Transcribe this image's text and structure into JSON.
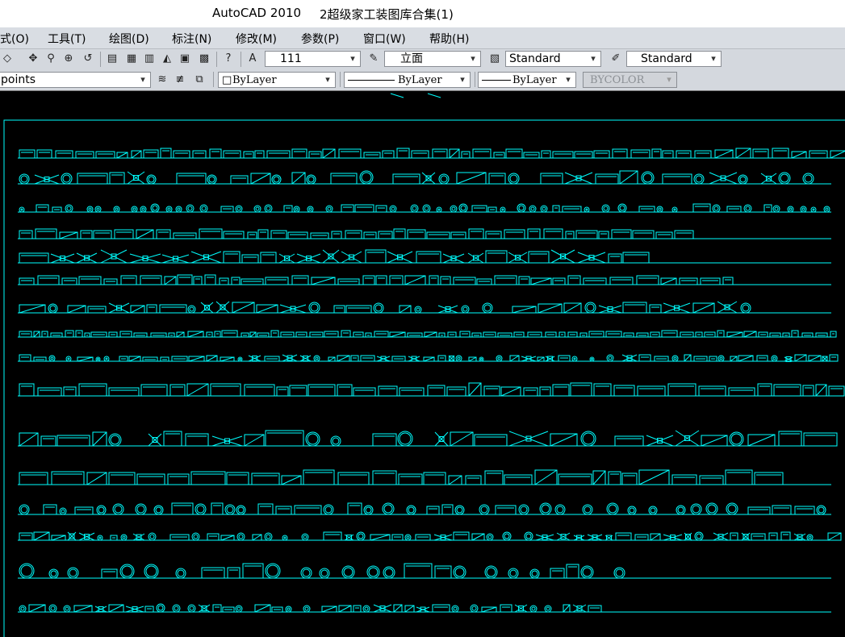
{
  "window": {
    "app_name": "AutoCAD 2010",
    "document": "2超级家工装图库合集(1)"
  },
  "menu": [
    "式(O)",
    "工具(T)",
    "绘图(D)",
    "标注(N)",
    "修改(M)",
    "参数(P)",
    "窗口(W)",
    "帮助(H)"
  ],
  "toolbar1": {
    "scale_value": "111",
    "view_value": "立面",
    "text_style": "Standard",
    "dim_style": "Standard"
  },
  "toolbar2": {
    "layer_value": "points",
    "color_value": "ByLayer",
    "linetype_value": "ByLayer",
    "lineweight_value": "ByLayer",
    "plotstyle_value": "BYCOLOR"
  },
  "colors": {
    "drawing": "#00ffff",
    "background": "#000000"
  }
}
